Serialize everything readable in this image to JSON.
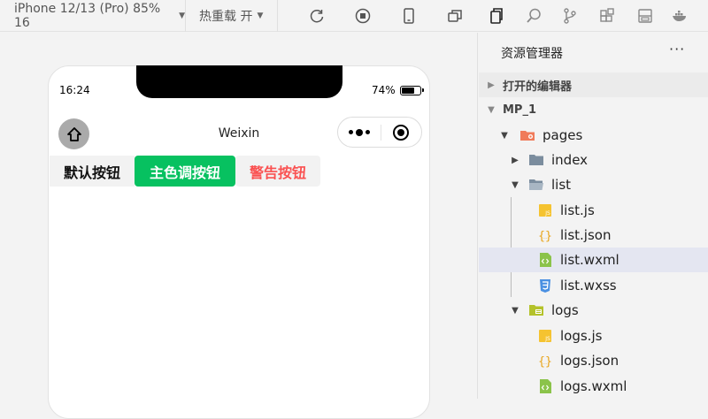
{
  "toolbar": {
    "device_label": "iPhone 12/13 (Pro) 85% 16",
    "hotreload_label": "热重载 开",
    "icons": [
      "refresh-icon",
      "stop-icon",
      "phone-icon",
      "window-icon",
      "files-icon",
      "search-icon",
      "branch-icon",
      "extensions-icon",
      "layout-icon",
      "docker-icon"
    ]
  },
  "simulator": {
    "status_time": "16:24",
    "battery_text": "74%",
    "battery_level": 0.74,
    "nav_title": "Weixin",
    "buttons": {
      "default": "默认按钮",
      "primary": "主色调按钮",
      "warn": "警告按钮"
    },
    "colors": {
      "primary": "#07c160",
      "warn": "#fa5151"
    }
  },
  "explorer": {
    "title": "资源管理器",
    "more": "···",
    "open_editors": "打开的编辑器",
    "project": "MP_1",
    "tree": {
      "pages": "pages",
      "index": "index",
      "list": "list",
      "list_js": "list.js",
      "list_json": "list.json",
      "list_wxml": "list.wxml",
      "list_wxss": "list.wxss",
      "logs": "logs",
      "logs_js": "logs.js",
      "logs_json": "logs.json",
      "logs_wxml": "logs.wxml"
    }
  }
}
